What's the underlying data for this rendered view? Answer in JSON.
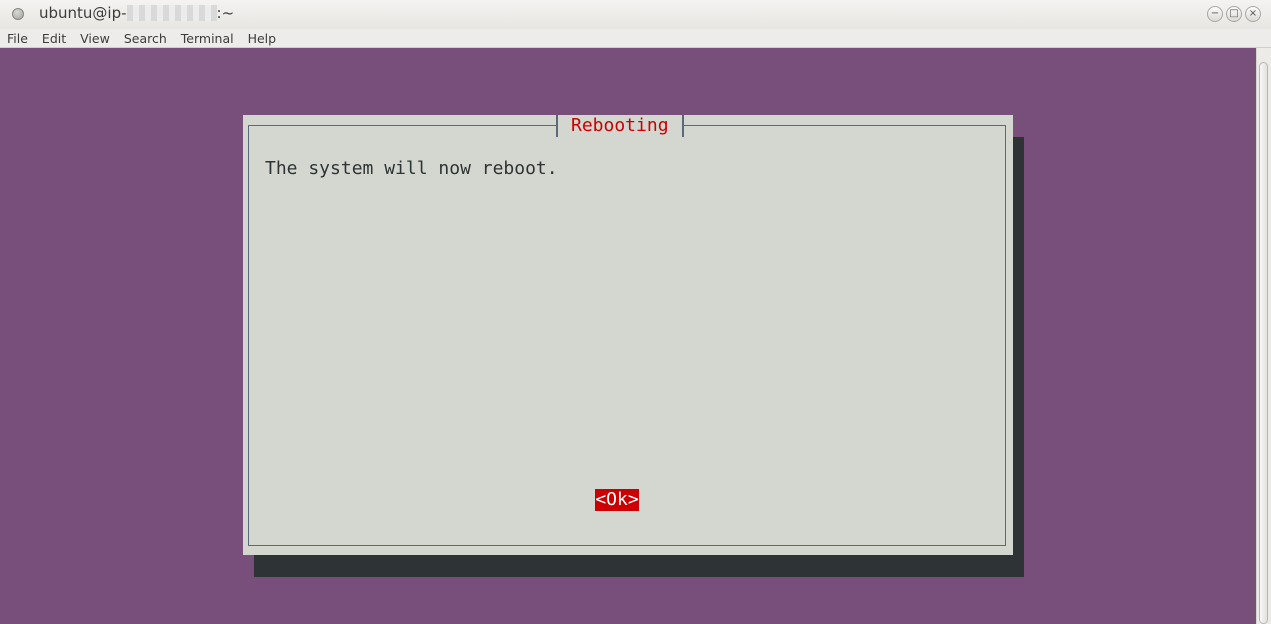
{
  "window": {
    "title_prefix": "ubuntu@ip-",
    "title_suffix": ":~"
  },
  "menu": [
    "File",
    "Edit",
    "View",
    "Search",
    "Terminal",
    "Help"
  ],
  "dialog": {
    "title": "Rebooting",
    "message": "The system will now reboot.",
    "ok_label": "<Ok>"
  },
  "colors": {
    "terminal_bg": "#774f7a",
    "dialog_bg": "#d3d7cf",
    "accent": "#cc0000"
  }
}
